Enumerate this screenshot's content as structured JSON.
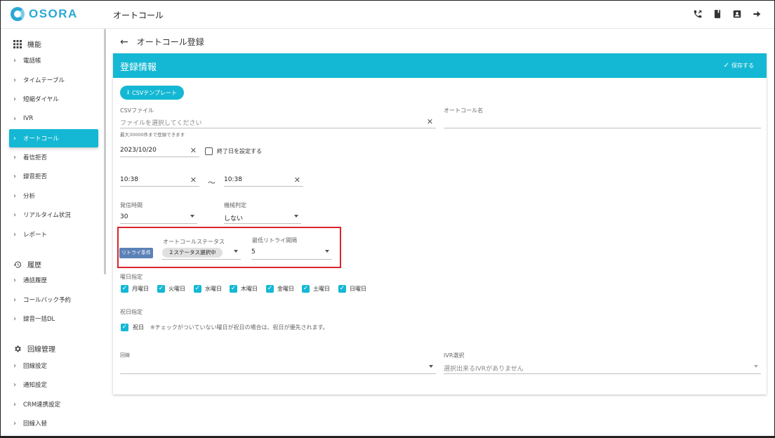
{
  "brand": {
    "name": "OSORA",
    "color": "#2aa8d6"
  },
  "header": {
    "title": "オートコール",
    "icons": [
      "phone-forward-icon",
      "book-icon",
      "contact-card-icon",
      "logout-icon"
    ]
  },
  "accent": "#14b8d4",
  "sidebar": {
    "sections": [
      {
        "title": "機能",
        "icon": "apps-grid-icon",
        "items": [
          "電話帳",
          "タイムテーブル",
          "短縮ダイヤル",
          "IVR",
          "オートコール",
          "着信拒否",
          "録音拒否",
          "分析",
          "リアルタイム状況",
          "レポート"
        ]
      },
      {
        "title": "履歴",
        "icon": "history-icon",
        "items": [
          "通話履歴",
          "コールバック予約",
          "録音一括DL"
        ]
      },
      {
        "title": "回線管理",
        "icon": "gear-icon",
        "items": [
          "回線設定",
          "通知設定",
          "CRM連携設定",
          "回線入替"
        ]
      }
    ],
    "active_item": "オートコール"
  },
  "page": {
    "back_icon": "arrow-left-icon",
    "title": "オートコール登録",
    "card_title": "登録情報",
    "save_label": "保存する",
    "csv_template_label": "CSVテンプレート",
    "csv_file": {
      "label": "CSVファイル",
      "placeholder": "ファイルを選択してください",
      "hint": "最大30000件まで登録できます"
    },
    "autocall_name": {
      "label": "オートコール名",
      "value": ""
    },
    "start_date": "2023/10/20",
    "end_date_checkbox": {
      "label": "終了日を設定する",
      "checked": false
    },
    "time_start": "10:38",
    "time_end": "10:38",
    "time_separator": "〜",
    "call_duration": {
      "label": "発信時間",
      "value": "30"
    },
    "machine_detection": {
      "label": "機械判定",
      "value": "しない"
    },
    "retry": {
      "tag": "リトライ条件",
      "status_label": "オートコールステータス",
      "status_value": "２ステータス選択中",
      "interval_label": "最低リトライ間隔",
      "interval_value": "5",
      "highlight_color": "#d9252a"
    },
    "weekday": {
      "label": "曜日指定",
      "days": [
        {
          "name": "月曜日",
          "checked": true
        },
        {
          "name": "火曜日",
          "checked": true
        },
        {
          "name": "水曜日",
          "checked": true
        },
        {
          "name": "木曜日",
          "checked": true
        },
        {
          "name": "金曜日",
          "checked": true
        },
        {
          "name": "土曜日",
          "checked": true
        },
        {
          "name": "日曜日",
          "checked": true
        }
      ]
    },
    "holiday": {
      "label": "祝日指定",
      "checkbox_label": "祝日",
      "checked": true,
      "note": "※チェックがついていない曜日が祝日の場合は、祝日が優先されます。"
    },
    "line": {
      "label": "回線",
      "value": ""
    },
    "ivr": {
      "label": "IVR選択",
      "placeholder": "選択出来るIVRがありません"
    }
  }
}
